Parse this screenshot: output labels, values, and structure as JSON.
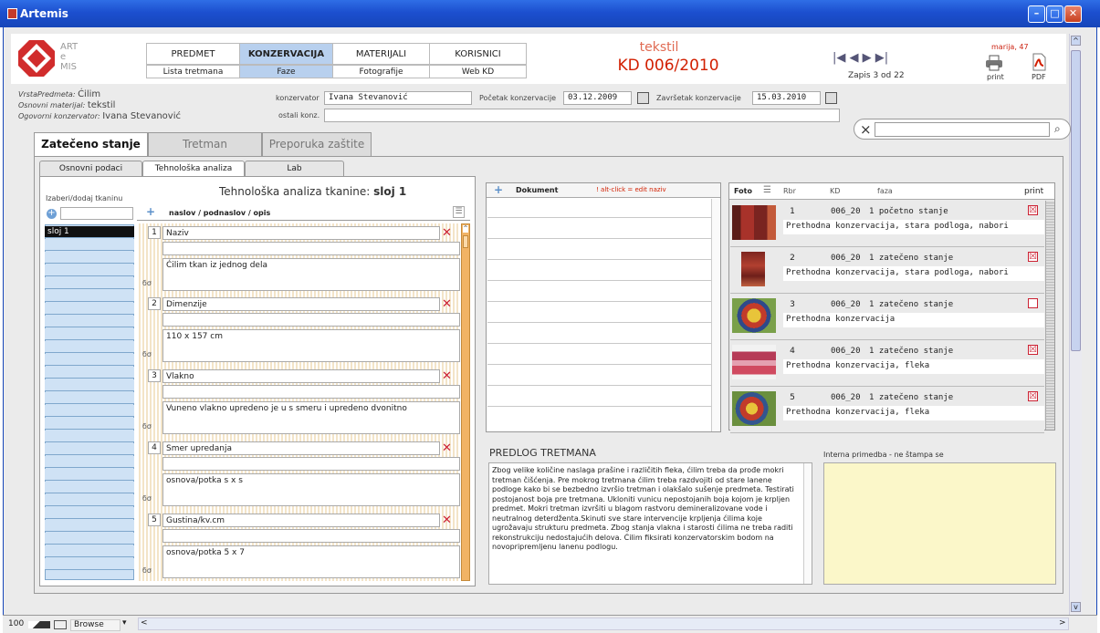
{
  "window": {
    "title": "Artemis"
  },
  "logo": {
    "l1": "ART",
    "l2": "e",
    "l3": "MIS"
  },
  "nav": {
    "top": [
      "PREDMET",
      "KONZERVACIJA",
      "MATERIJALI",
      "KORISNICI"
    ],
    "bottom": [
      "Lista tretmana",
      "Faze",
      "Fotografije",
      "Web KD"
    ]
  },
  "record": {
    "type": "tekstil",
    "kd": "KD 006/2010",
    "pager": "|◀ ◀ ▶ ▶|",
    "zapis": "Zapis 3 od 22"
  },
  "user": "marija, 47",
  "actions": {
    "print": "print",
    "pdf": "PDF"
  },
  "info": {
    "vrsta_label": "VrstaPredmeta:",
    "vrsta": "Ćilim",
    "materijal_label": "Osnovni materijal:",
    "materijal": "tekstil",
    "ogovorni_label": "Ogovorni konzervator:",
    "ogovorni": "Ivana Stevanović",
    "konzervator_label": "konzervator",
    "konzervator": "Ivana Stevanović",
    "ostali_label": "ostali konz.",
    "ostali": "",
    "pocetak_label": "Početak konzervacije",
    "pocetak": "03.12.2009",
    "zavrsetak_label": "Završetak konzervacije",
    "zavrsetak": "15.03.2010"
  },
  "search": {
    "clear": "×",
    "value": "",
    "go": "⌕"
  },
  "tabs": [
    "Zatečeno stanje",
    "Tretman",
    "Preporuka zaštite"
  ],
  "subtabs": [
    "Osnovni podaci",
    "Tehnološka analiza",
    "Lab"
  ],
  "analysis": {
    "izaberi": "Izaberi/dodaj tkaninu",
    "title_prefix": "Tehnološka analiza tkanine:",
    "title_value": "sloj 1",
    "col_header": "naslov / podnaslov / opis",
    "layers": [
      "sloj 1"
    ],
    "rows": [
      {
        "num": "1",
        "naslov": "Naziv",
        "opis": "Ćilim tkan iz jednog dela"
      },
      {
        "num": "2",
        "naslov": "Dimenzije",
        "opis": "110 x 157 cm"
      },
      {
        "num": "3",
        "naslov": "Vlakno",
        "opis": "Vuneno vlakno upredeno je u s smeru i upredeno dvonitno"
      },
      {
        "num": "4",
        "naslov": "Smer upredanja",
        "opis": "osnova/potka  s x s"
      },
      {
        "num": "5",
        "naslov": "Gustina/kv.cm",
        "opis": "osnova/potka 5 x 7"
      }
    ],
    "eye": "ϭσ",
    "del": "✕",
    "plus": "+"
  },
  "documents": {
    "header": "Dokument",
    "hint": "! alt-click = edit naziv"
  },
  "photos": {
    "headers": {
      "foto": "Foto",
      "rbr": "Rbr",
      "kd": "KD",
      "faza": "faza",
      "print": "print"
    },
    "rows": [
      {
        "rbr": "1",
        "kd": "006_20",
        "faza": "1 početno stanje",
        "desc": "Prethodna konzervacija, stara podloga, nabori",
        "checked": "☒"
      },
      {
        "rbr": "2",
        "kd": "006_20",
        "faza": "1 zatečeno stanje",
        "desc": "Prethodna konzervacija, stara podloga, nabori",
        "checked": "☒"
      },
      {
        "rbr": "3",
        "kd": "006_20",
        "faza": "1 zatečeno stanje",
        "desc": "Prethodna konzervacija",
        "checked": ""
      },
      {
        "rbr": "4",
        "kd": "006_20",
        "faza": "1 zatečeno stanje",
        "desc": "Prethodna konzervacija, fleka",
        "checked": "☒"
      },
      {
        "rbr": "5",
        "kd": "006_20",
        "faza": "1 zatečeno stanje",
        "desc": "Prethodna konzervacija, fleka",
        "checked": "☒"
      }
    ]
  },
  "predlog": {
    "title": "PREDLOG TRETMANA",
    "text": "Zbog velike količine naslaga prašine i različitih fleka, ćilim treba da prođe mokri tretman čišćenja. Pre mokrog tretmana ćilim treba razdvojiti od stare lanene podloge kako bi se bezbedno izvršio tretman i olakšalo sušenje predmeta. Testirati postojanost boja pre tretmana. Ukloniti vunicu nepostojanih boja kojom je krpljen predmet. Mokri tretman izvršiti u blagom rastvoru demineralizovane vode i neutralnog deterdženta.Skinuti sve stare intervencije krpljenja ćilima koje ugrožavaju strukturu predmeta. Zbog stanja vlakna i starosti ćilima ne treba raditi rekonstrukciju nedostajućih delova. Ćilim fiksirati konzervatorskim bodom na novopripremljenu lanenu podlogu."
  },
  "interna": {
    "title": "Interna primedba - ne štampa se",
    "text": ""
  },
  "status": {
    "zoom": "100",
    "mode": "Browse"
  },
  "colors": {
    "accent": "#b8d0ee",
    "kd": "#d21f00",
    "titlebar": "#1c4fcf",
    "delete": "#cc2233"
  }
}
